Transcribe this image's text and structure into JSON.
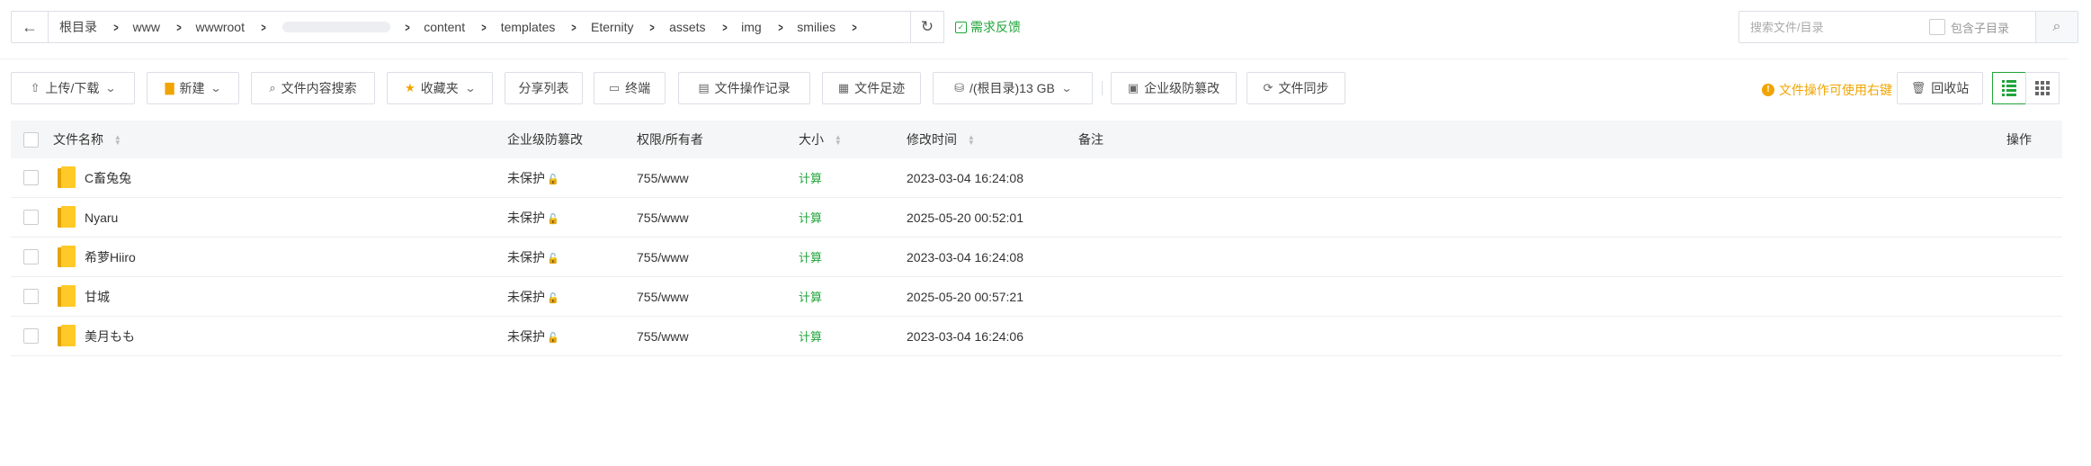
{
  "path": {
    "segments": [
      "根目录",
      "www",
      "wwwroot",
      "",
      "content",
      "templates",
      "Eternity",
      "assets",
      "img",
      "smilies"
    ],
    "feedback": "需求反馈"
  },
  "search": {
    "placeholder": "搜索文件/目录",
    "subdir_label": "包含子目录"
  },
  "toolbar": {
    "upload": "上传/下载",
    "new": "新建",
    "content_search": "文件内容搜索",
    "favorites": "收藏夹",
    "share_list": "分享列表",
    "terminal": "终端",
    "op_log": "文件操作记录",
    "footprint": "文件足迹",
    "disk": "/(根目录)13 GB",
    "tamper": "企业级防篡改",
    "sync": "文件同步",
    "tip": "文件操作可使用右键",
    "recycle": "回收站"
  },
  "table": {
    "headers": {
      "name": "文件名称",
      "protection": "企业级防篡改",
      "permission": "权限/所有者",
      "size": "大小",
      "mtime": "修改时间",
      "note": "备注",
      "ops": "操作"
    },
    "rows": [
      {
        "name": "C畜兔兔",
        "protection": "未保护",
        "permission": "755/www",
        "size": "计算",
        "mtime": "2023-03-04 16:24:08"
      },
      {
        "name": "Nyaru",
        "protection": "未保护",
        "permission": "755/www",
        "size": "计算",
        "mtime": "2025-05-20 00:52:01"
      },
      {
        "name": "希萝Hiiro",
        "protection": "未保护",
        "permission": "755/www",
        "size": "计算",
        "mtime": "2023-03-04 16:24:08"
      },
      {
        "name": "甘城",
        "protection": "未保护",
        "permission": "755/www",
        "size": "计算",
        "mtime": "2025-05-20 00:57:21"
      },
      {
        "name": "美月もも",
        "protection": "未保护",
        "permission": "755/www",
        "size": "计算",
        "mtime": "2023-03-04 16:24:06"
      }
    ]
  },
  "colors": {
    "accent": "#20a53a",
    "warning": "#f0a400",
    "folder": "#ffc928"
  }
}
